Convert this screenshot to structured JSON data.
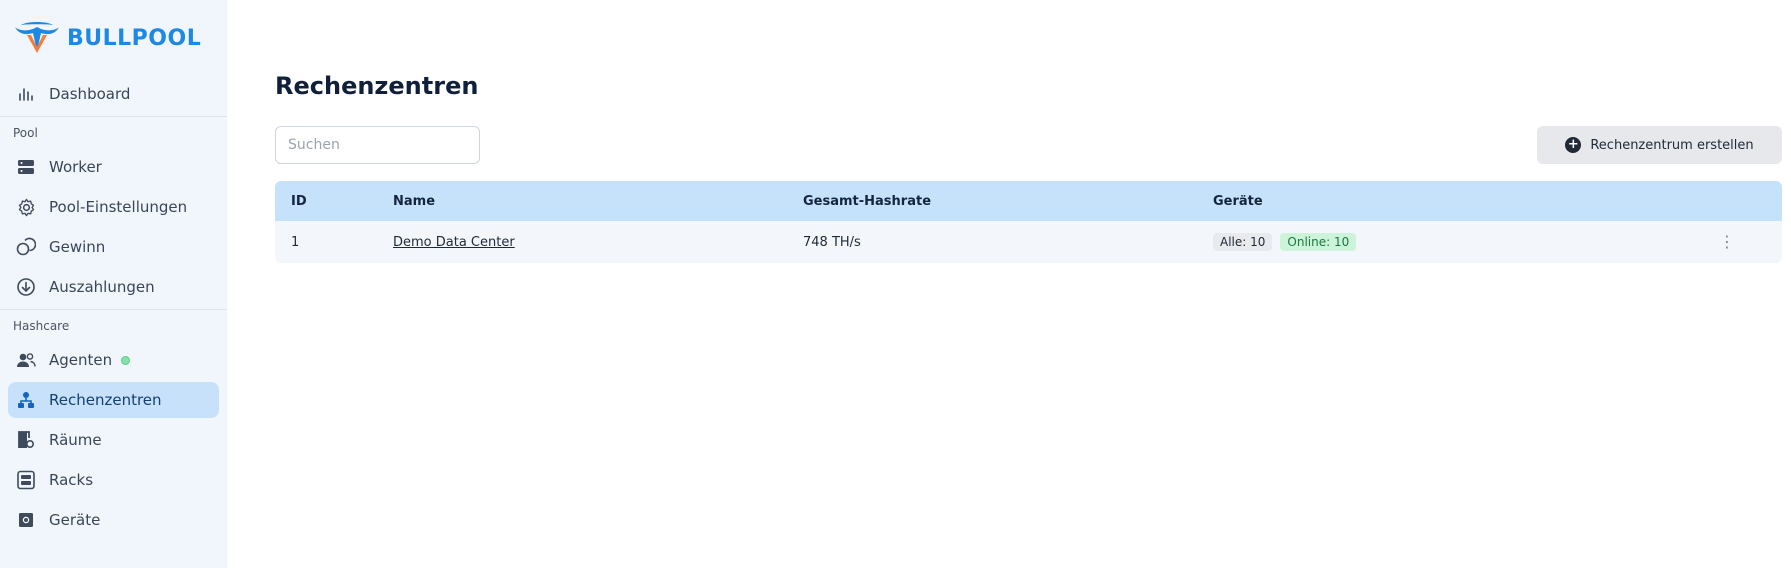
{
  "brand": {
    "name": "BULLPOOL",
    "logo_icon": "bull-horns-logo",
    "color": "#1e88e5"
  },
  "sidebar": {
    "top_items": [
      {
        "label": "Dashboard",
        "icon": "bar-chart-icon"
      }
    ],
    "sections": [
      {
        "title": "Pool",
        "items": [
          {
            "label": "Worker",
            "icon": "server-icon"
          },
          {
            "label": "Pool-Einstellungen",
            "icon": "gear-icon"
          },
          {
            "label": "Gewinn",
            "icon": "coins-icon"
          },
          {
            "label": "Auszahlungen",
            "icon": "download-circle-icon"
          }
        ]
      },
      {
        "title": "Hashcare",
        "items": [
          {
            "label": "Agenten",
            "icon": "users-icon",
            "status": "online"
          },
          {
            "label": "Rechenzentren",
            "icon": "hierarchy-icon",
            "active": true
          },
          {
            "label": "Räume",
            "icon": "room-gear-icon"
          },
          {
            "label": "Racks",
            "icon": "rack-icon"
          },
          {
            "label": "Geräte",
            "icon": "chip-icon"
          }
        ]
      }
    ]
  },
  "page": {
    "title": "Rechenzentren",
    "search_placeholder": "Suchen",
    "create_button": "Rechenzentrum erstellen"
  },
  "table": {
    "columns": [
      "ID",
      "Name",
      "Gesamt-Hashrate",
      "Geräte"
    ],
    "rows": [
      {
        "id": "1",
        "name": "Demo Data Center",
        "hashrate": "748 TH/s",
        "all": "Alle: 10",
        "online": "Online: 10"
      }
    ]
  },
  "colors": {
    "accent": "#1e88e5",
    "active_bg": "#c7e1fb",
    "header_bg": "#c6e2fb",
    "online": "#177a3c"
  }
}
